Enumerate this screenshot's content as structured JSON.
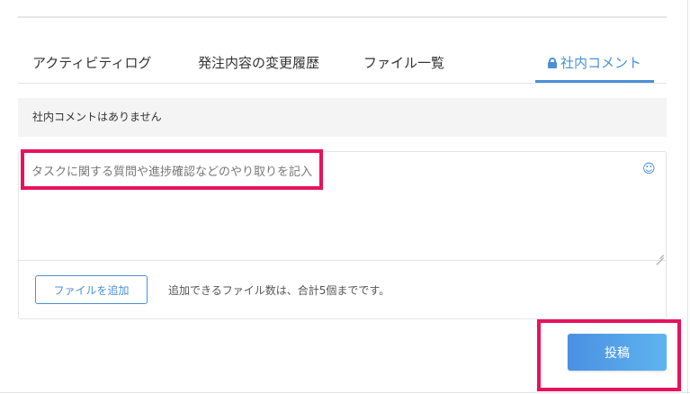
{
  "tabs": [
    {
      "label": "アクティビティログ",
      "active": false
    },
    {
      "label": "発注内容の変更履歴",
      "active": false
    },
    {
      "label": "ファイル一覧",
      "active": false
    },
    {
      "label": "社内コメント",
      "active": true,
      "icon": "lock-icon"
    }
  ],
  "comments": {
    "empty_message": "社内コメントはありません"
  },
  "compose": {
    "placeholder": "タスクに関する質問や進捗確認などのやり取りを記入",
    "value": "",
    "emoji_icon": "smiley-icon",
    "add_file_label": "ファイルを追加",
    "file_limit_note": "追加できるファイル数は、合計5個までです。"
  },
  "post": {
    "label": "投稿"
  },
  "colors": {
    "accent": "#4a90d9",
    "highlight": "#e8125c",
    "button_gradient_start": "#4a90e2",
    "button_gradient_end": "#5eb4ef"
  }
}
